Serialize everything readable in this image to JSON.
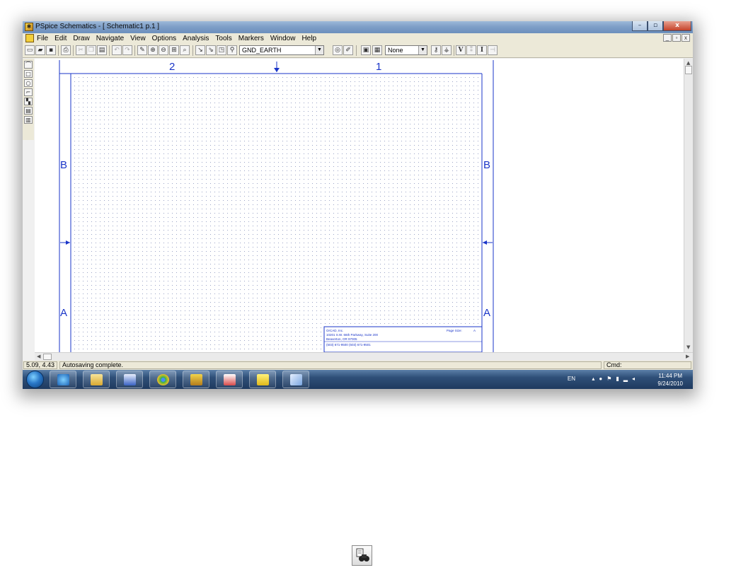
{
  "window": {
    "title": "PSpice Schematics - [ Schematic1  p.1  ]",
    "caption_buttons": [
      "–",
      "▫",
      "x"
    ]
  },
  "menubar": {
    "items": [
      "File",
      "Edit",
      "Draw",
      "Navigate",
      "View",
      "Options",
      "Analysis",
      "Tools",
      "Markers",
      "Window",
      "Help"
    ],
    "mdi_buttons": [
      "_",
      "▫",
      "x"
    ]
  },
  "toolbar": {
    "ground_combo": "GND_EARTH",
    "marker_combo": "None",
    "v_label": "V",
    "i_label": "I"
  },
  "schematic": {
    "zone_top_left": "2",
    "zone_top_right": "1",
    "zone_row_upper": "B",
    "zone_row_lower": "A",
    "title_block": {
      "company": "OrCAD, Inc.",
      "address1": "10201 S.W. 66th Parkway, Suite 200",
      "address2": "Beaverton, OR 97005",
      "phone": "(503) 671-9500     (503) 671-9501",
      "page_size_label": "Page Size:",
      "page_size_value": "A"
    }
  },
  "statusbar": {
    "coords": "5.09, 4.43",
    "message": "Autosaving complete.",
    "cmd_label": "Cmd:"
  },
  "taskbar": {
    "language": "EN",
    "time": "11:44 PM",
    "date": "9/24/2010"
  },
  "colors": {
    "schematic_border": "#1a35c8",
    "title_bar": "#7f9fc7",
    "taskbar": "#2f4f78"
  }
}
